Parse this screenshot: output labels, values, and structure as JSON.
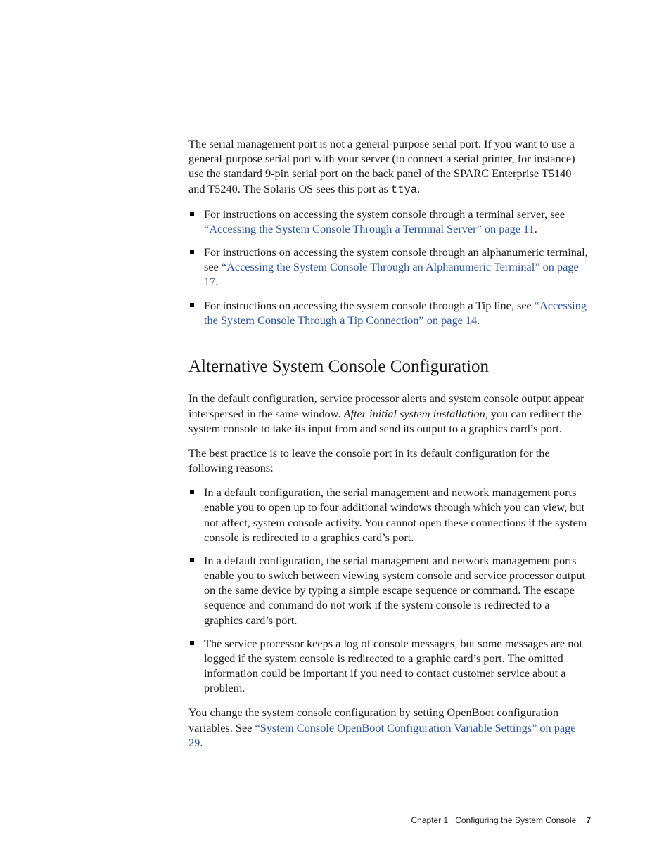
{
  "intro": {
    "p1a": "The serial management port is not a general-purpose serial port. If you want to use a general-purpose serial port with your server (to connect a serial printer, for instance) use the standard 9-pin serial port on the back panel of the SPARC Enterprise T5140 and T5240. The Solaris OS sees this port as ",
    "tty": "ttya",
    "p1b": "."
  },
  "bullets1": {
    "b1_pre": "For instructions on accessing the system console through a terminal server, see ",
    "b1_link": "“Accessing the System Console Through a Terminal Server” on page 11",
    "b1_post": ".",
    "b2_pre": "For instructions on accessing the system console through an alphanumeric terminal, see ",
    "b2_link": "“Accessing the System Console Through an Alphanumeric Terminal” on page 17",
    "b2_post": ".",
    "b3_pre": "For instructions on accessing the system console through a Tip line, see ",
    "b3_link": "“Accessing the System Console Through a Tip  Connection” on page 14",
    "b3_post": "."
  },
  "section": {
    "heading": "Alternative System Console Configuration",
    "p1a": "In the default configuration, service processor alerts and system console output appear interspersed in the same window. ",
    "p1_em": "After initial system installation",
    "p1b": ", you can redirect the system console to take its input from and send its output to a graphics card’s port.",
    "p2": "The best practice is to leave the console port in its default configuration for the following reasons:"
  },
  "bullets2": {
    "b1": "In a default configuration, the serial management and network management ports enable you to open up to four additional windows through which you can view, but not affect, system console activity. You cannot open these connections if the system console is redirected to a graphics card’s port.",
    "b2": "In a default configuration, the serial management and network management ports enable you to switch between viewing system console and service processor output on the same device by typing a simple escape sequence or command. The escape sequence and command do not work if the system console is redirected to a graphics card’s port.",
    "b3": "The service processor keeps a log of console messages, but some messages are not logged if the system console is redirected to a graphic card’s port. The omitted information could be important if you need to contact customer service about a problem."
  },
  "closing": {
    "pre": "You change the system console configuration by setting OpenBoot configuration variables. See ",
    "link": "“System Console OpenBoot Configuration Variable Settings” on page 29",
    "post": "."
  },
  "footer": {
    "chapter": "Chapter 1",
    "title": "Configuring the System Console",
    "page": "7"
  }
}
